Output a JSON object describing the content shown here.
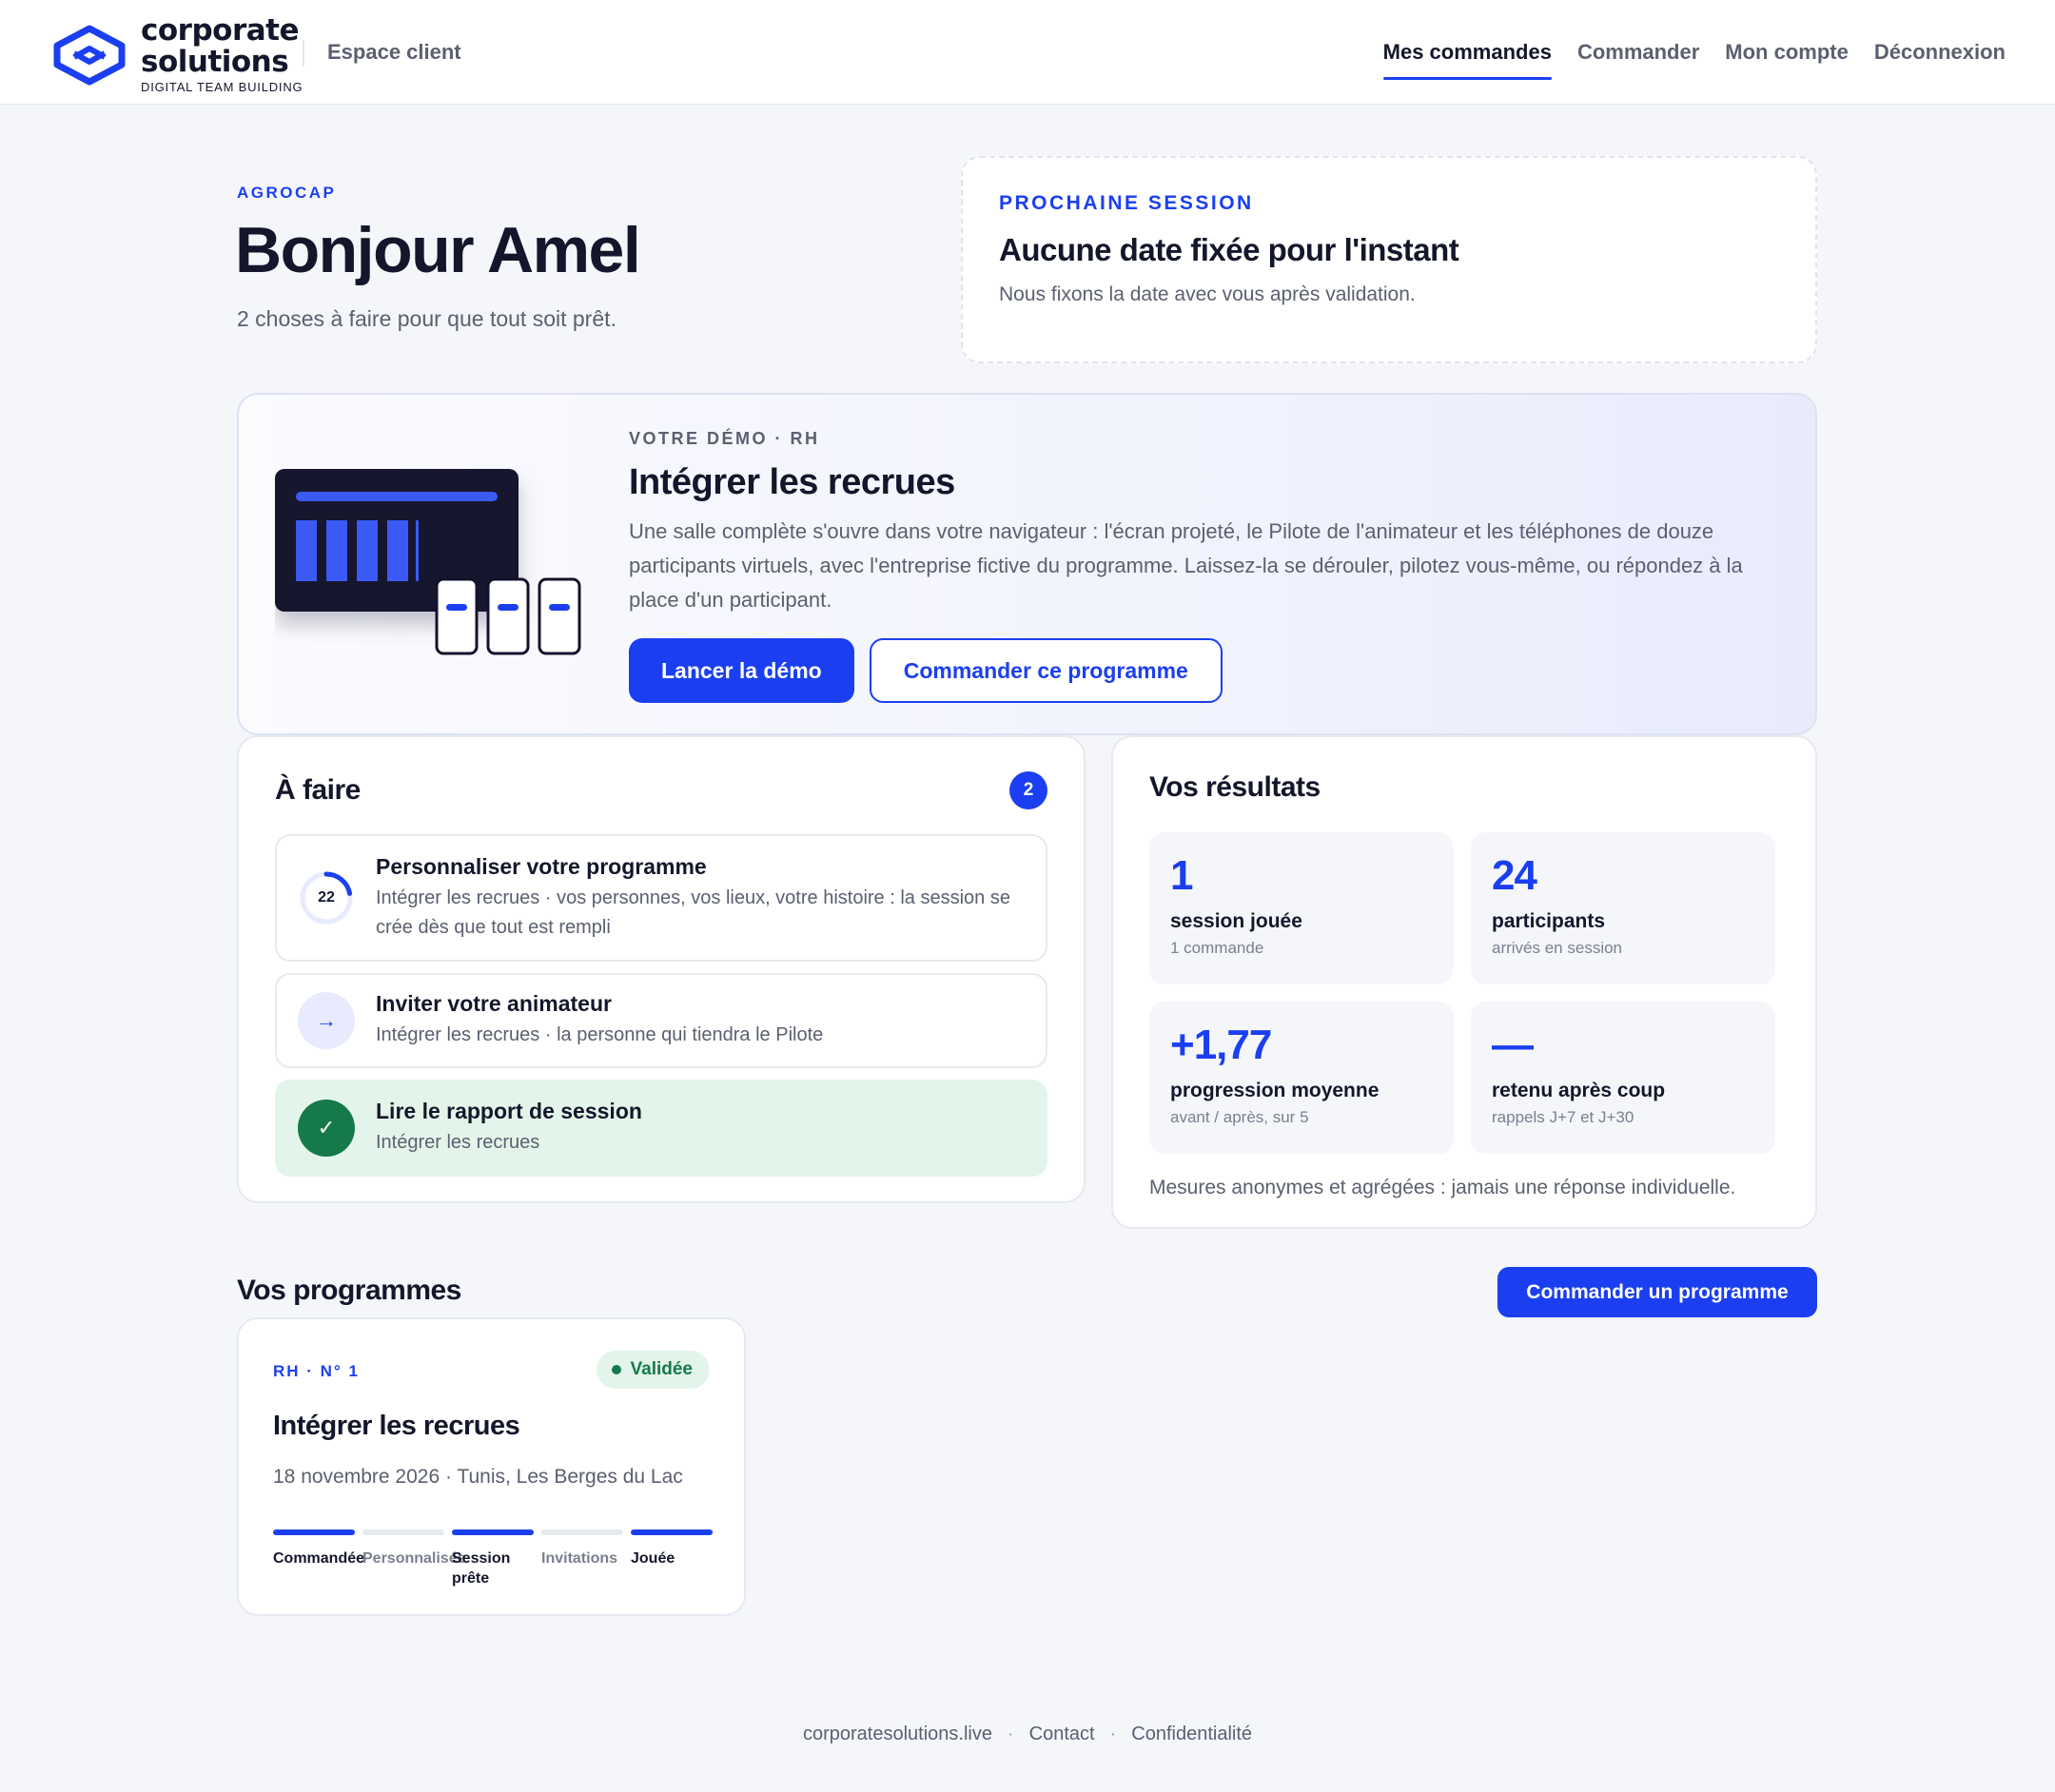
{
  "header": {
    "brand_line1": "corporate",
    "brand_line2": "solutions",
    "brand_tagline": "DIGITAL TEAM BUILDING",
    "portal_label": "Espace client",
    "nav": [
      {
        "label": "Mes commandes",
        "active": true
      },
      {
        "label": "Commander",
        "active": false
      },
      {
        "label": "Mon compte",
        "active": false
      },
      {
        "label": "Déconnexion",
        "active": false
      }
    ]
  },
  "hero": {
    "company": "AGROCAP",
    "greeting": "Bonjour Amel",
    "subtitle": "2 choses à faire pour que tout soit prêt."
  },
  "next_session": {
    "label": "PROCHAINE SESSION",
    "title": "Aucune date fixée pour l'instant",
    "subtitle": "Nous fixons la date avec vous après validation."
  },
  "demo": {
    "eyebrow": "VOTRE DÉMO · RH",
    "title": "Intégrer les recrues",
    "description": "Une salle complète s'ouvre dans votre navigateur : l'écran projeté, le Pilote de l'animateur et les téléphones de douze participants virtuels, avec l'entreprise fictive du programme. Laissez-la se dérouler, pilotez vous-même, ou répondez à la place d'un participant.",
    "primary_button": "Lancer la démo",
    "secondary_button": "Commander ce programme"
  },
  "todo": {
    "title": "À faire",
    "count": "2",
    "tasks": [
      {
        "title": "Personnaliser votre programme",
        "subtitle": "Intégrer les recrues · vos personnes, vos lieux, votre histoire : la session se crée dès que tout est rempli",
        "progress_value": "22",
        "progress_fraction": 0.22
      },
      {
        "title": "Inviter votre animateur",
        "subtitle": "Intégrer les recrues · la personne qui tiendra le Pilote",
        "icon_glyph": "→"
      },
      {
        "title": "Lire le rapport de session",
        "subtitle": "Intégrer les recrues",
        "icon_glyph": "✓"
      }
    ]
  },
  "results": {
    "title": "Vos résultats",
    "metrics": [
      {
        "value": "1",
        "label": "session jouée",
        "sub": "1 commande"
      },
      {
        "value": "24",
        "label": "participants",
        "sub": "arrivés en session"
      },
      {
        "value": "+1,77",
        "label": "progression moyenne",
        "sub": "avant / après, sur 5"
      },
      {
        "value": "—",
        "label": "retenu après coup",
        "sub": "rappels J+7 et J+30"
      }
    ],
    "note": "Mesures anonymes et agrégées : jamais une réponse individuelle."
  },
  "programs": {
    "title": "Vos programmes",
    "order_button": "Commander un programme",
    "items": [
      {
        "tag": "RH · N° 1",
        "status": "Validée",
        "title": "Intégrer les recrues",
        "meta": "18 novembre 2026 · Tunis, Les Berges du Lac",
        "steps": [
          {
            "label": "Commandée",
            "done": true
          },
          {
            "label": "Personnalisée",
            "done": false
          },
          {
            "label": "Session prête",
            "done": true
          },
          {
            "label": "Invitations",
            "done": false
          },
          {
            "label": "Jouée",
            "done": true
          }
        ]
      }
    ]
  },
  "footer": {
    "site": "corporatesolutions.live",
    "separator": "·",
    "contact": "Contact",
    "privacy": "Confidentialité"
  },
  "colors": {
    "accent": "#1b3ff0",
    "text": "#14172b",
    "muted": "#5b6070",
    "success": "#16794a",
    "success_bg": "#e3f5ea",
    "background": "#f4f6fa"
  }
}
